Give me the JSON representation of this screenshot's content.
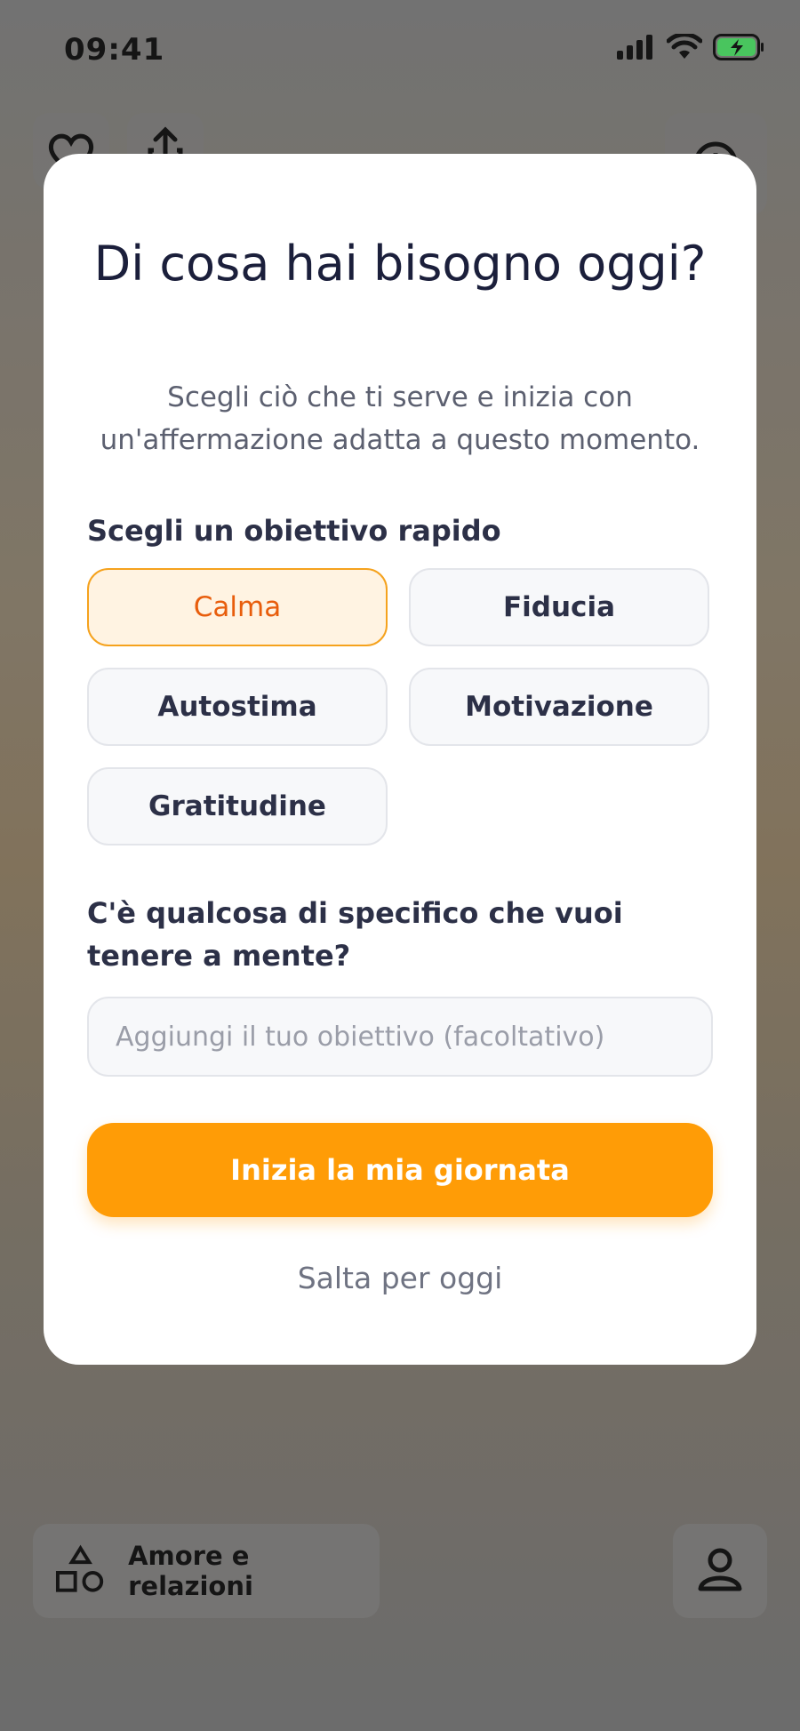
{
  "status_bar": {
    "time": "09:41"
  },
  "modal": {
    "title": "Di cosa hai bisogno oggi?",
    "subtitle": "Scegli ciò che ti serve e inizia con un'affermazione adatta a questo momento.",
    "quick_goal_label": "Scegli un obiettivo rapido",
    "chips": [
      {
        "label": "Calma",
        "selected": true
      },
      {
        "label": "Fiducia",
        "selected": false
      },
      {
        "label": "Autostima",
        "selected": false
      },
      {
        "label": "Motivazione",
        "selected": false
      },
      {
        "label": "Gratitudine",
        "selected": false
      }
    ],
    "specific_label": "C'è qualcosa di specifico che vuoi tenere a mente?",
    "goal_input": {
      "value": "",
      "placeholder": "Aggiungi il tuo obiettivo (facoltativo)"
    },
    "primary_button": "Inizia la mia giornata",
    "skip_link": "Salta per oggi"
  },
  "background": {
    "category_button": "Amore e relazioni"
  },
  "colors": {
    "accent": "#ff9c06",
    "selected_chip_bg": "#fff3e2",
    "selected_chip_text": "#e85d0c",
    "title": "#1b1f3b"
  }
}
